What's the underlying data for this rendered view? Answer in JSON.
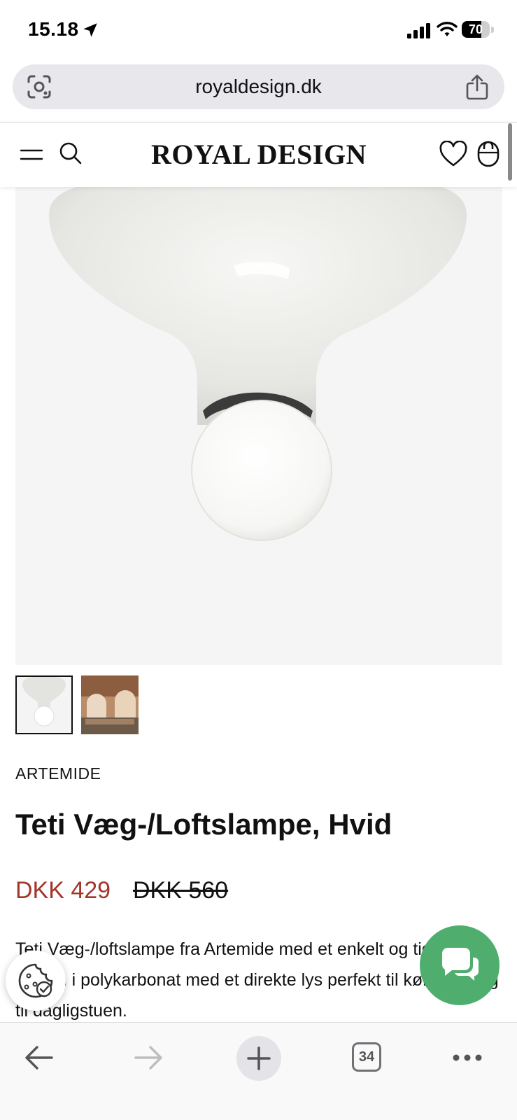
{
  "status_bar": {
    "time": "15.18",
    "battery": "70",
    "battery_level": 0.7
  },
  "browser": {
    "url": "royaldesign.dk",
    "tab_count": "34"
  },
  "site_header": {
    "logo": "ROYAL DESIGN"
  },
  "product": {
    "brand": "ARTEMIDE",
    "title": "Teti Væg-/Loftslampe, Hvid",
    "price": "DKK 429",
    "old_price": "DKK 560",
    "description": "Teti Væg-/loftslampe fra Artemide med et enkelt og tidløst design i polykarbonat med et direkte lys perfekt til køkkenet og til dagligstuen.",
    "thumbnail_count": 2
  },
  "colors": {
    "sale_price": "#a3352a",
    "chat_button": "#4fae6e",
    "address_bar": "#e7e7ec"
  },
  "icons": {
    "status": [
      "location-arrow-icon",
      "signal-icon",
      "wifi-icon",
      "battery-icon"
    ],
    "address_bar": [
      "visual-lookup-icon",
      "share-icon"
    ],
    "header": [
      "menu-icon",
      "search-icon",
      "heart-icon",
      "bag-icon"
    ],
    "floating": [
      "cookie-icon",
      "chat-icon"
    ],
    "toolbar": [
      "back-arrow-icon",
      "forward-arrow-icon",
      "plus-icon",
      "tabs-icon",
      "more-icon"
    ]
  }
}
